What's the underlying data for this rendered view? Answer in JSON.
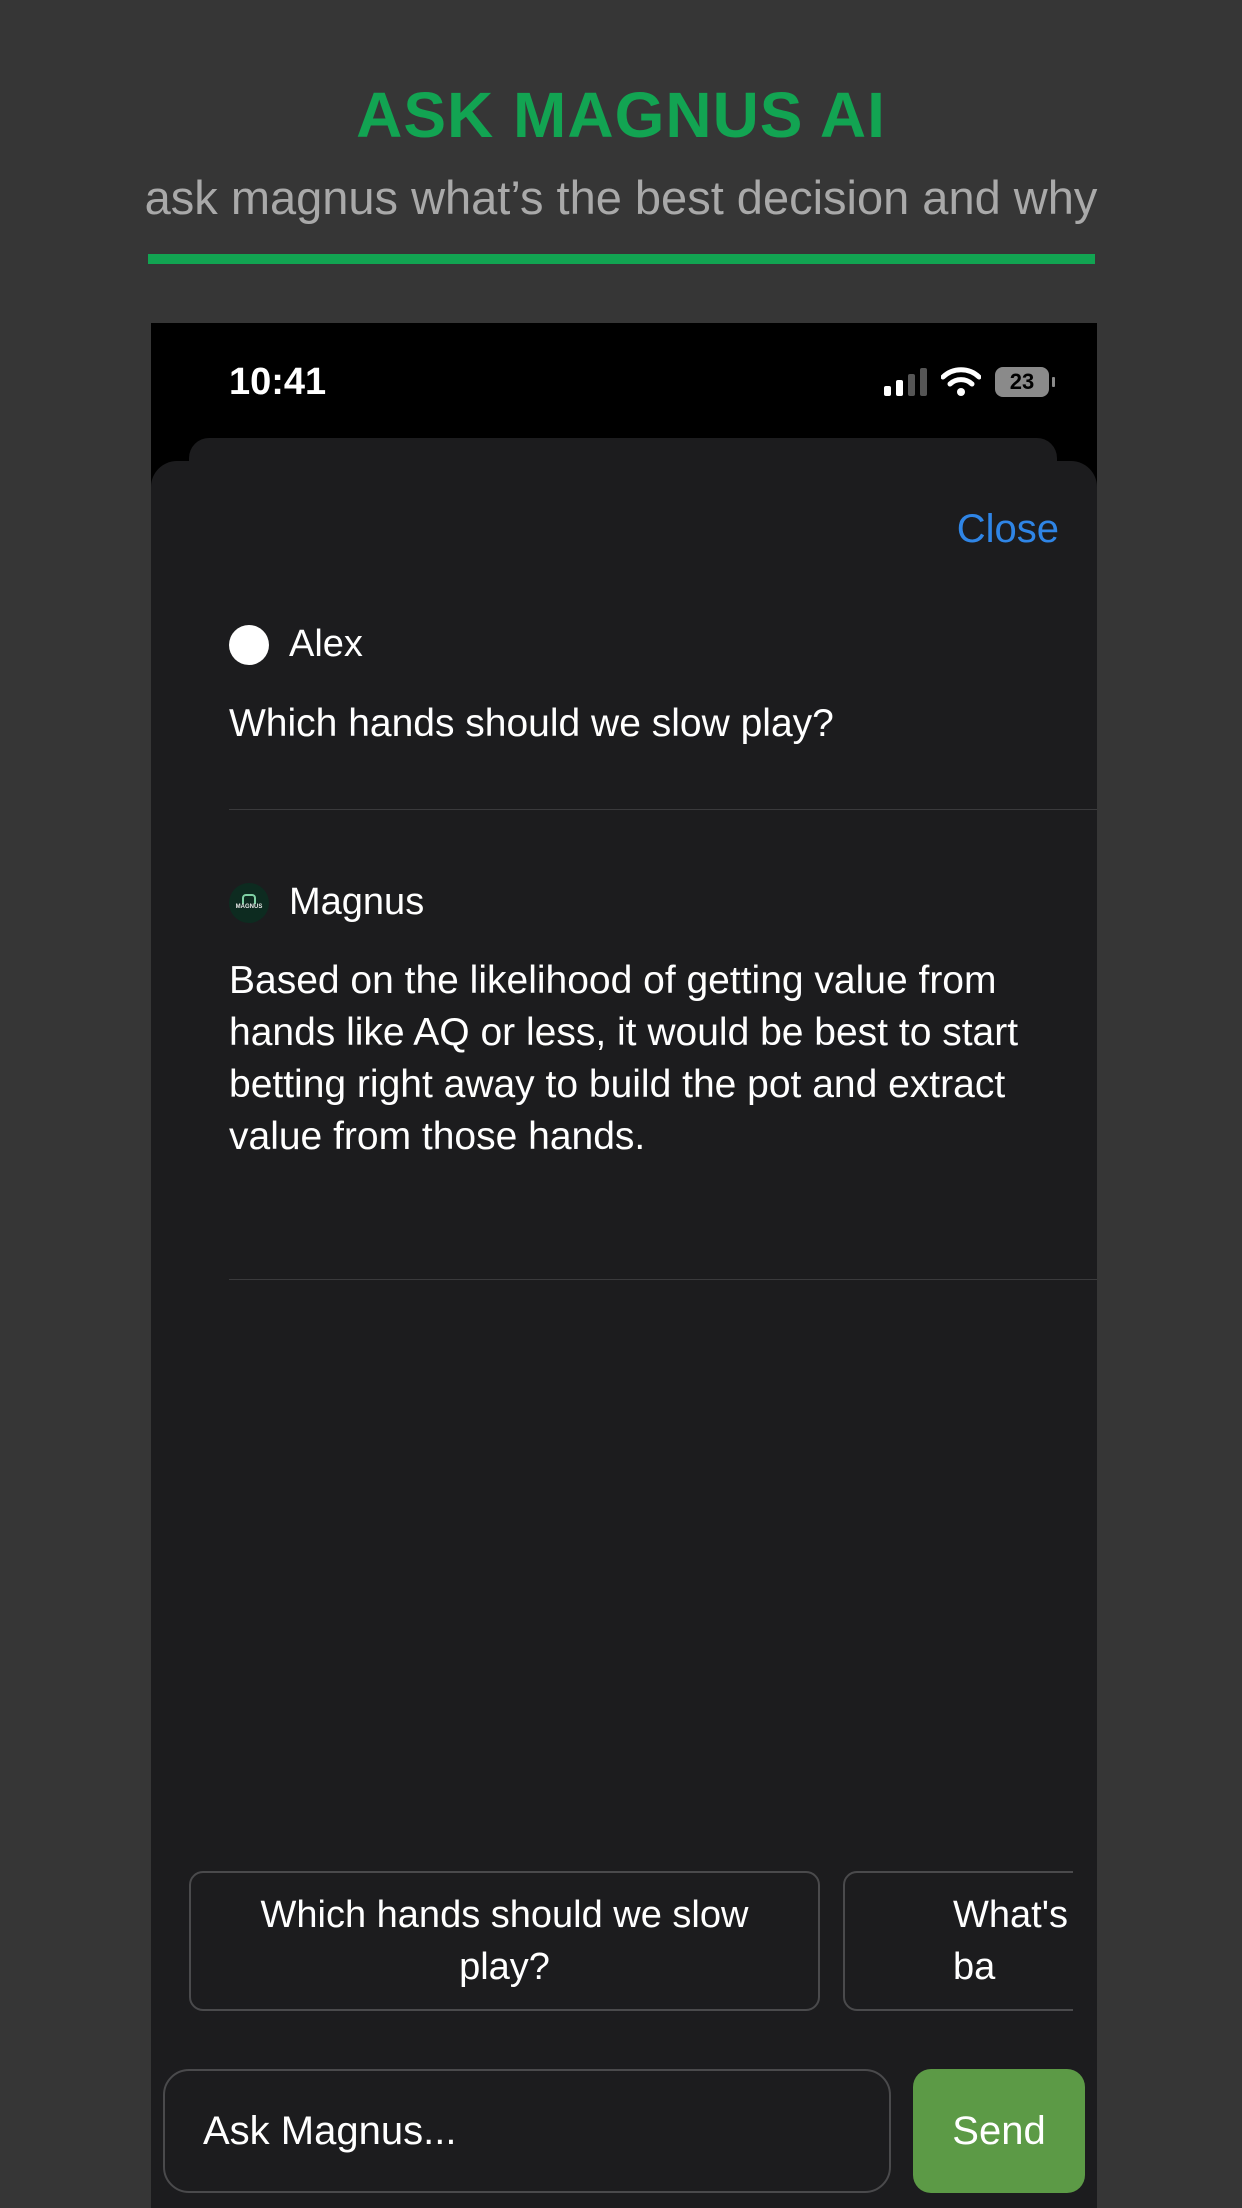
{
  "promo": {
    "title": "ASK MAGNUS AI",
    "subtitle": "ask magnus what’s the best decision and why"
  },
  "status_bar": {
    "time": "10:41",
    "battery": "23"
  },
  "sheet": {
    "close_label": "Close"
  },
  "messages": [
    {
      "author": "Alex",
      "text": "Which hands should we slow play?"
    },
    {
      "author": "Magnus",
      "text": "Based on the likelihood of getting value from hands like AQ or less, it would be best to start betting right away to build the pot and extract value from those hands."
    }
  ],
  "suggestions": [
    "Which hands should we slow play?",
    "What's ba"
  ],
  "composer": {
    "placeholder": "Ask Magnus...",
    "send_label": "Send"
  },
  "colors": {
    "accent_green": "#12a452",
    "link_blue": "#2f85e6",
    "send_green": "#5c9a46"
  }
}
